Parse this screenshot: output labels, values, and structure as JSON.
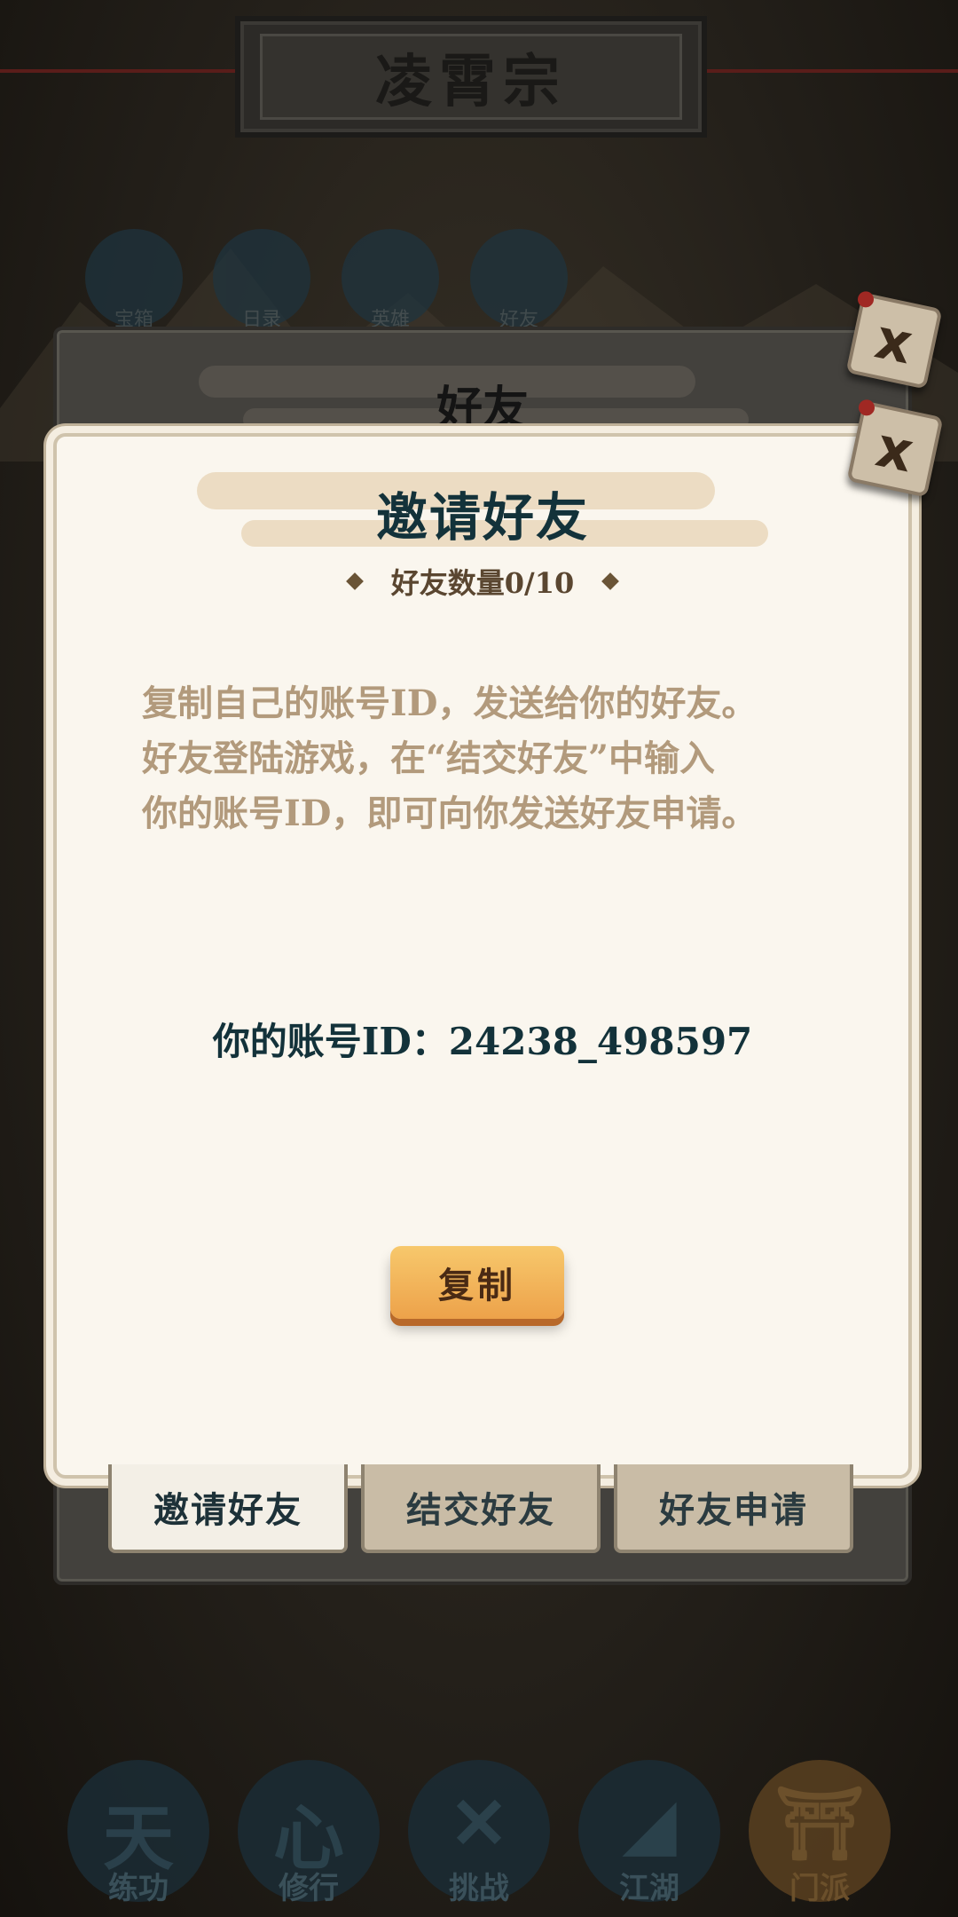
{
  "banner": {
    "title": "凌霄宗"
  },
  "top_icons": [
    {
      "label": "宝箱",
      "icon": "bag-icon"
    },
    {
      "label": "日录",
      "icon": "scroll-icon"
    },
    {
      "label": "英雄",
      "icon": "flower-icon"
    },
    {
      "label": "好友",
      "icon": "people-icon"
    }
  ],
  "back_panel": {
    "title": "好友"
  },
  "dialog": {
    "title": "邀请好友",
    "count_label": "好友数量0/10",
    "description": [
      "复制自己的账号ID，发送给你的好友。",
      "好友登陆游戏，在“结交好友”中输入",
      "你的账号ID，即可向你发送好友申请。"
    ],
    "account_label": "你的账号ID：24238_498597",
    "copy_button": "复制",
    "close_icon": "x"
  },
  "tabs": [
    {
      "label": "邀请好友",
      "active": true
    },
    {
      "label": "结交好友",
      "active": false
    },
    {
      "label": "好友申请",
      "active": false
    }
  ],
  "bottom_nav": [
    {
      "label": "练功",
      "glyph": "天",
      "icon": "train-icon"
    },
    {
      "label": "修行",
      "glyph": "心",
      "icon": "heart-icon"
    },
    {
      "label": "挑战",
      "glyph": "✕",
      "icon": "swords-icon"
    },
    {
      "label": "江湖",
      "glyph": "◢",
      "icon": "mountain-icon"
    },
    {
      "label": "门派",
      "glyph": "⛩",
      "icon": "gate-icon"
    }
  ],
  "colors": {
    "accent": "#eda24a",
    "title": "#13323a",
    "text_muted": "#b29a7c"
  }
}
